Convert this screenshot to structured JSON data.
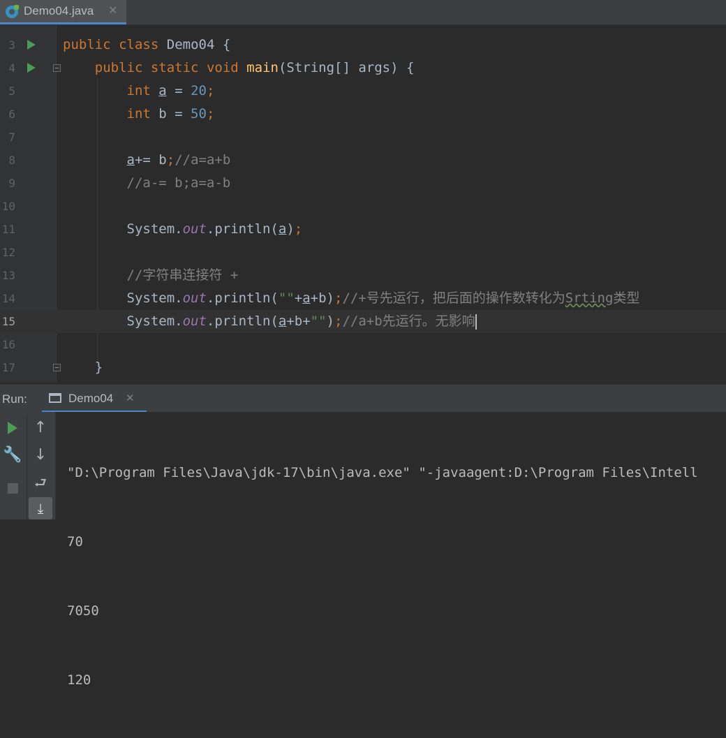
{
  "tab": {
    "filename": "Demo04.java",
    "close": "✕"
  },
  "editor": {
    "lines": [
      {
        "num": "3"
      },
      {
        "num": "4"
      },
      {
        "num": "5"
      },
      {
        "num": "6"
      },
      {
        "num": "7"
      },
      {
        "num": "8"
      },
      {
        "num": "9"
      },
      {
        "num": "10"
      },
      {
        "num": "11"
      },
      {
        "num": "12"
      },
      {
        "num": "13"
      },
      {
        "num": "14"
      },
      {
        "num": "15"
      },
      {
        "num": "16"
      },
      {
        "num": "17"
      }
    ],
    "tokens": {
      "l3_public": "public",
      "l3_class": "class",
      "l3_name": "Demo04",
      "l3_brace": "{",
      "l4_public": "public",
      "l4_static": "static",
      "l4_void": "void",
      "l4_main": "main",
      "l4_params_open": "(String[] args)",
      "l4_brace": "{",
      "l5_int": "int",
      "l5_var": "a",
      "l5_eq": " = ",
      "l5_val": "20",
      "l5_semi": ";",
      "l6_int": "int",
      "l6_var": " b = ",
      "l6_val": "50",
      "l6_semi": ";",
      "l8_var": "a",
      "l8_op": "+= b",
      "l8_semi": ";",
      "l8_cmt": "//a=a+b",
      "l9_cmt": "//a-= b;a=a-b",
      "l11_sys": "System.",
      "l11_out": "out",
      "l11_print": ".println(",
      "l11_arg": "a",
      "l11_close": ")",
      "l11_semi": ";",
      "l13_cmt": "//字符串连接符 +",
      "l14_sys": "System.",
      "l14_out": "out",
      "l14_print": ".println(",
      "l14_str": "\"\"",
      "l14_plus": "+",
      "l14_a": "a",
      "l14_rest": "+b)",
      "l14_semi": ";",
      "l14_cmt1": "//+号先运行，把后面的操作数转化为",
      "l14_cmt2": "Srting",
      "l14_cmt3": "类型",
      "l15_sys": "System.",
      "l15_out": "out",
      "l15_print": ".println(",
      "l15_a": "a",
      "l15_plus": "+b+",
      "l15_str": "\"\"",
      "l15_close": ")",
      "l15_semi": ";",
      "l15_cmt": "//a+b先运行。无影响",
      "l17_brace": "}"
    }
  },
  "run_panel": {
    "label": "Run:",
    "tab_name": "Demo04",
    "tab_close": "✕",
    "toolbar": {
      "rerun": "",
      "settings": "🔧",
      "stop": "",
      "up": "↑",
      "down": "↓",
      "soft_wrap": "⮐",
      "scroll_end": "⤓"
    },
    "output": [
      "\"D:\\Program Files\\Java\\jdk-17\\bin\\java.exe\" \"-javaagent:D:\\Program Files\\Intell",
      "70",
      "7050",
      "120"
    ]
  },
  "colors": {
    "keyword": "#cc7832",
    "number": "#6897bb",
    "method": "#ffc66d",
    "field": "#9876aa",
    "string": "#6a8759",
    "comment": "#808080",
    "text": "#a9b7c6"
  }
}
